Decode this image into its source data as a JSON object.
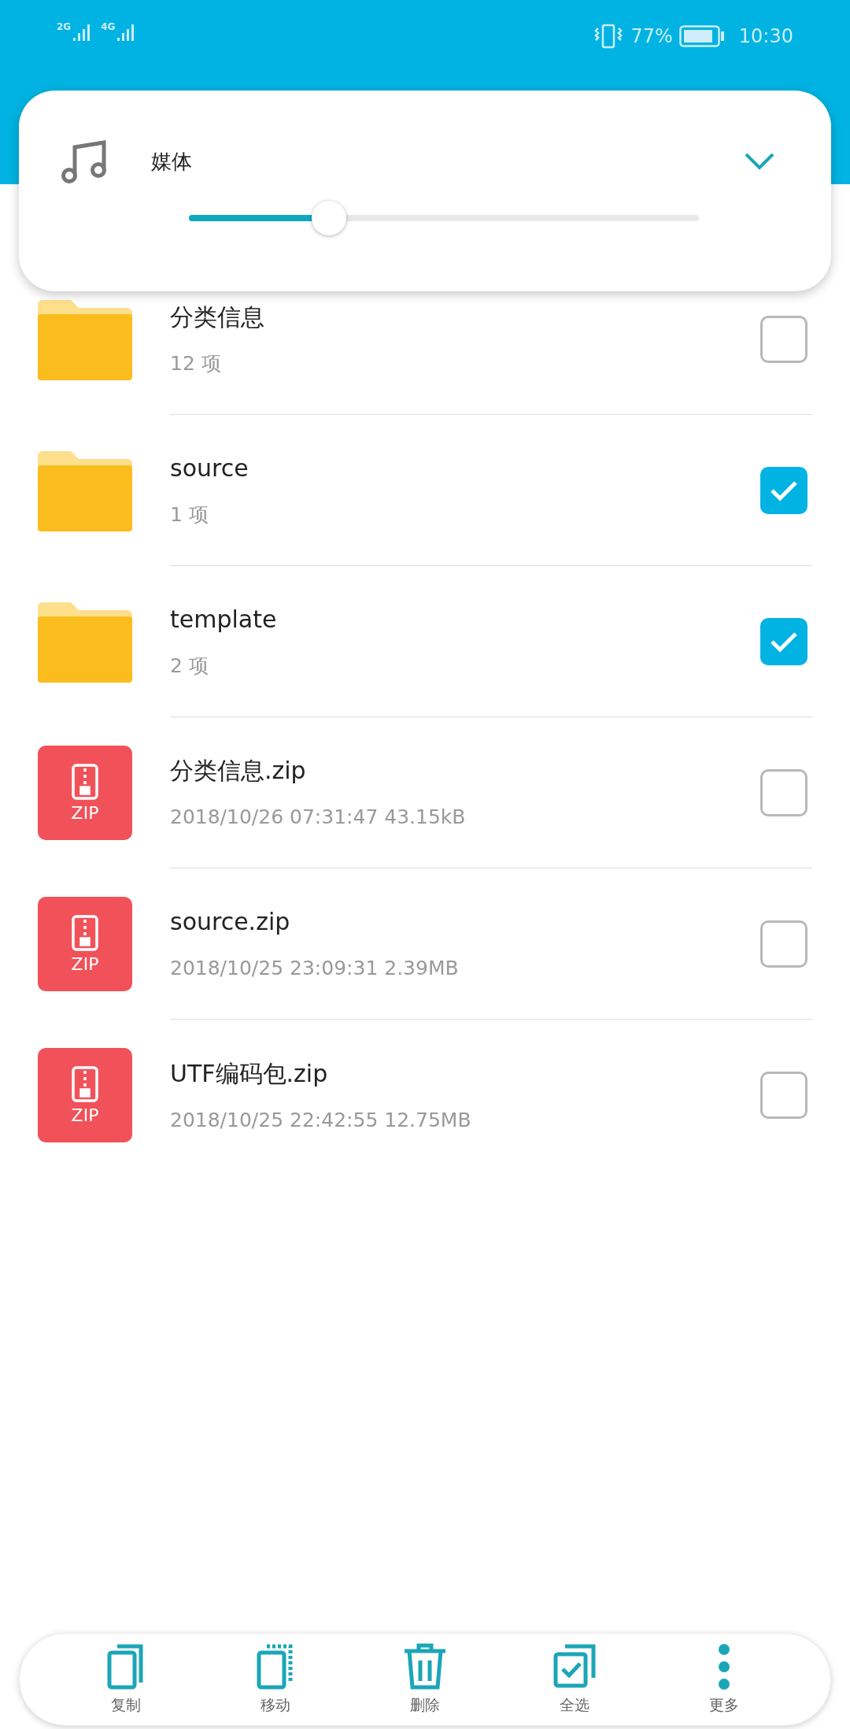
{
  "status_bar": {
    "network_1": "2G",
    "network_2": "4G",
    "battery": "77%",
    "time": "10:30"
  },
  "volume_panel": {
    "label": "媒体",
    "level": 0.275,
    "expanded": false
  },
  "files": [
    {
      "kind": "folder",
      "name": "分类信息",
      "detail": "12 项",
      "checked": false
    },
    {
      "kind": "folder",
      "name": "source",
      "detail": "1 项",
      "checked": true
    },
    {
      "kind": "folder",
      "name": "template",
      "detail": "2 项",
      "checked": true
    },
    {
      "kind": "zip",
      "badge": "ZIP",
      "name": "分类信息.zip",
      "detail": "2018/10/26 07:31:47 43.15kB",
      "checked": false
    },
    {
      "kind": "zip",
      "badge": "ZIP",
      "name": "source.zip",
      "detail": "2018/10/25 23:09:31 2.39MB",
      "checked": false
    },
    {
      "kind": "zip",
      "badge": "ZIP",
      "name": "UTF编码包.zip",
      "detail": "2018/10/25 22:42:55 12.75MB",
      "checked": false
    }
  ],
  "toolbar": [
    {
      "kind": "copy",
      "label": "复制"
    },
    {
      "kind": "move",
      "label": "移动"
    },
    {
      "kind": "delete",
      "label": "删除"
    },
    {
      "kind": "select_all",
      "label": "全选"
    },
    {
      "kind": "more",
      "label": "更多"
    }
  ]
}
